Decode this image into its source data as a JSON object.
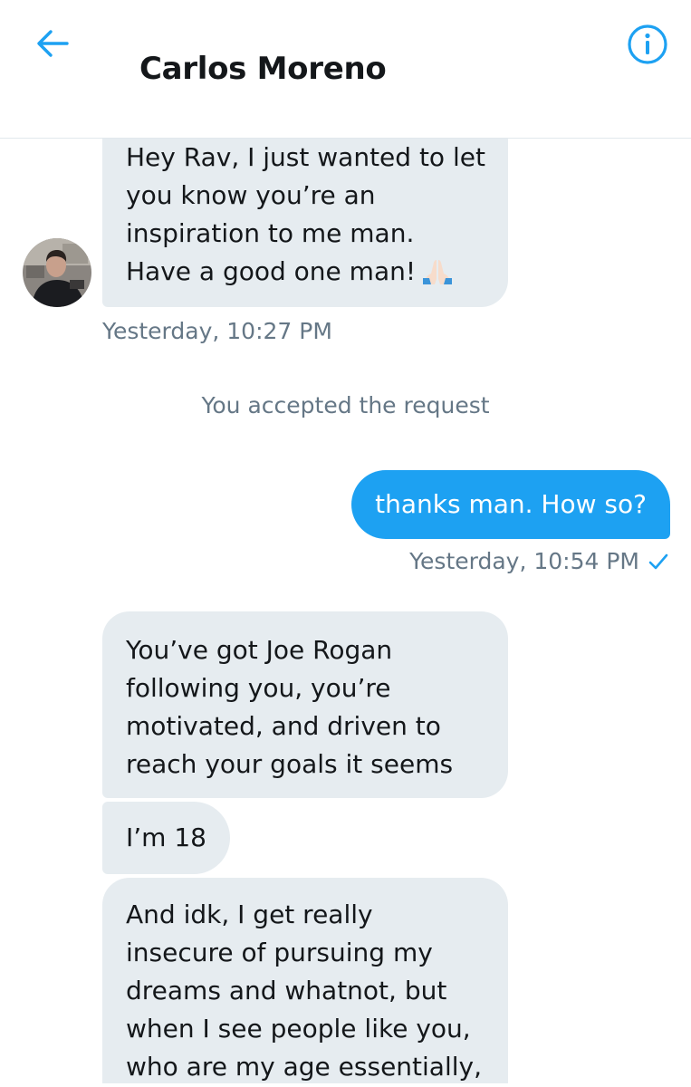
{
  "header": {
    "contact_name": "Carlos Moreno",
    "back_icon": "arrow-left-icon",
    "info_icon": "info-circle-icon",
    "accent_color": "#1da1f2"
  },
  "messages": {
    "incoming_1": "Hey Rav, I just wanted to let\nyou know you’re an\ninspiration to me man.\nHave a good one man!",
    "incoming_1_emoji": "folded-hands-emoji",
    "incoming_1_time": "Yesterday, 10:27 PM",
    "system_notice": "You accepted the request",
    "outgoing_1": "thanks man. How so?",
    "outgoing_1_time": "Yesterday, 10:54 PM",
    "outgoing_1_status_icon": "checkmark-icon",
    "incoming_2": "You’ve got Joe Rogan\nfollowing you, you’re\nmotivated, and driven to\nreach your goals it seems",
    "incoming_3": "I’m 18",
    "incoming_4": "And idk, I get really\ninsecure of pursuing my\ndreams and whatnot, but\nwhen I see people like you,\nwho are my age essentially,"
  },
  "colors": {
    "incoming_bubble": "#e6ecf0",
    "outgoing_bubble": "#1da1f2",
    "meta_text": "#657786"
  }
}
